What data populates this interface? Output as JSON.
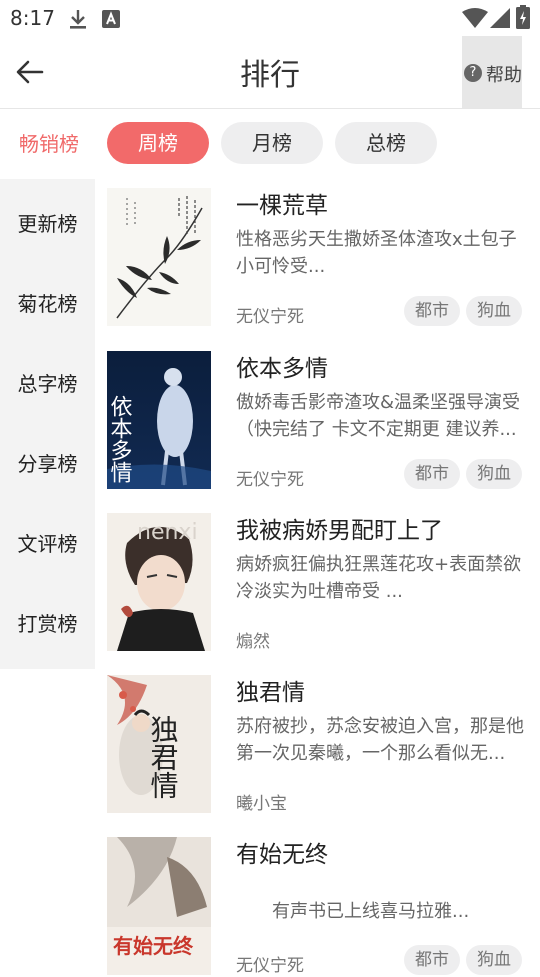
{
  "status_bar": {
    "time": "8:17"
  },
  "header": {
    "title": "排行",
    "help_label": "帮助",
    "help_glyph": "?"
  },
  "sidebar": {
    "items": [
      {
        "label": "畅销榜"
      },
      {
        "label": "更新榜"
      },
      {
        "label": "菊花榜"
      },
      {
        "label": "总字榜"
      },
      {
        "label": "分享榜"
      },
      {
        "label": "文评榜"
      },
      {
        "label": "打赏榜"
      }
    ],
    "active_index": 0
  },
  "tabs": [
    {
      "label": "周榜"
    },
    {
      "label": "月榜"
    },
    {
      "label": "总榜"
    }
  ],
  "books": [
    {
      "title": "一棵荒草",
      "desc": "性格恶劣天生撒娇圣体渣攻x土包子小可怜受...",
      "author": "无仪宁死",
      "tags": [
        "都市",
        "狗血"
      ]
    },
    {
      "title": "依本多情",
      "desc": "傲娇毒舌影帝渣攻&温柔坚强导演受（快完结了 卡文不定期更 建议养...",
      "author": "无仪宁死",
      "tags": [
        "都市",
        "狗血"
      ]
    },
    {
      "title": "我被病娇男配盯上了",
      "desc": "病娇疯狂偏执狂黑莲花攻+表面禁欲冷淡实为吐槽帝受 ...",
      "author": "煽然",
      "tags": []
    },
    {
      "title": "独君情",
      "desc": "苏府被抄，苏念安被迫入宫，那是他第一次见秦曦，一个那么看似无...",
      "author": "曦小宝",
      "tags": []
    },
    {
      "title": "有始无终",
      "desc": "有声书已上线喜马拉雅...",
      "author": "无仪宁死",
      "tags": [
        "都市",
        "狗血"
      ]
    }
  ],
  "cover_text": {
    "book2": "依本多情",
    "book3": "nenxi",
    "book4": "独君情",
    "book5": "有始无终"
  },
  "colors": {
    "accent": "#f26a6a",
    "tag_bg": "#eeeeef",
    "sidebar_bg": "#f3f3f3"
  }
}
